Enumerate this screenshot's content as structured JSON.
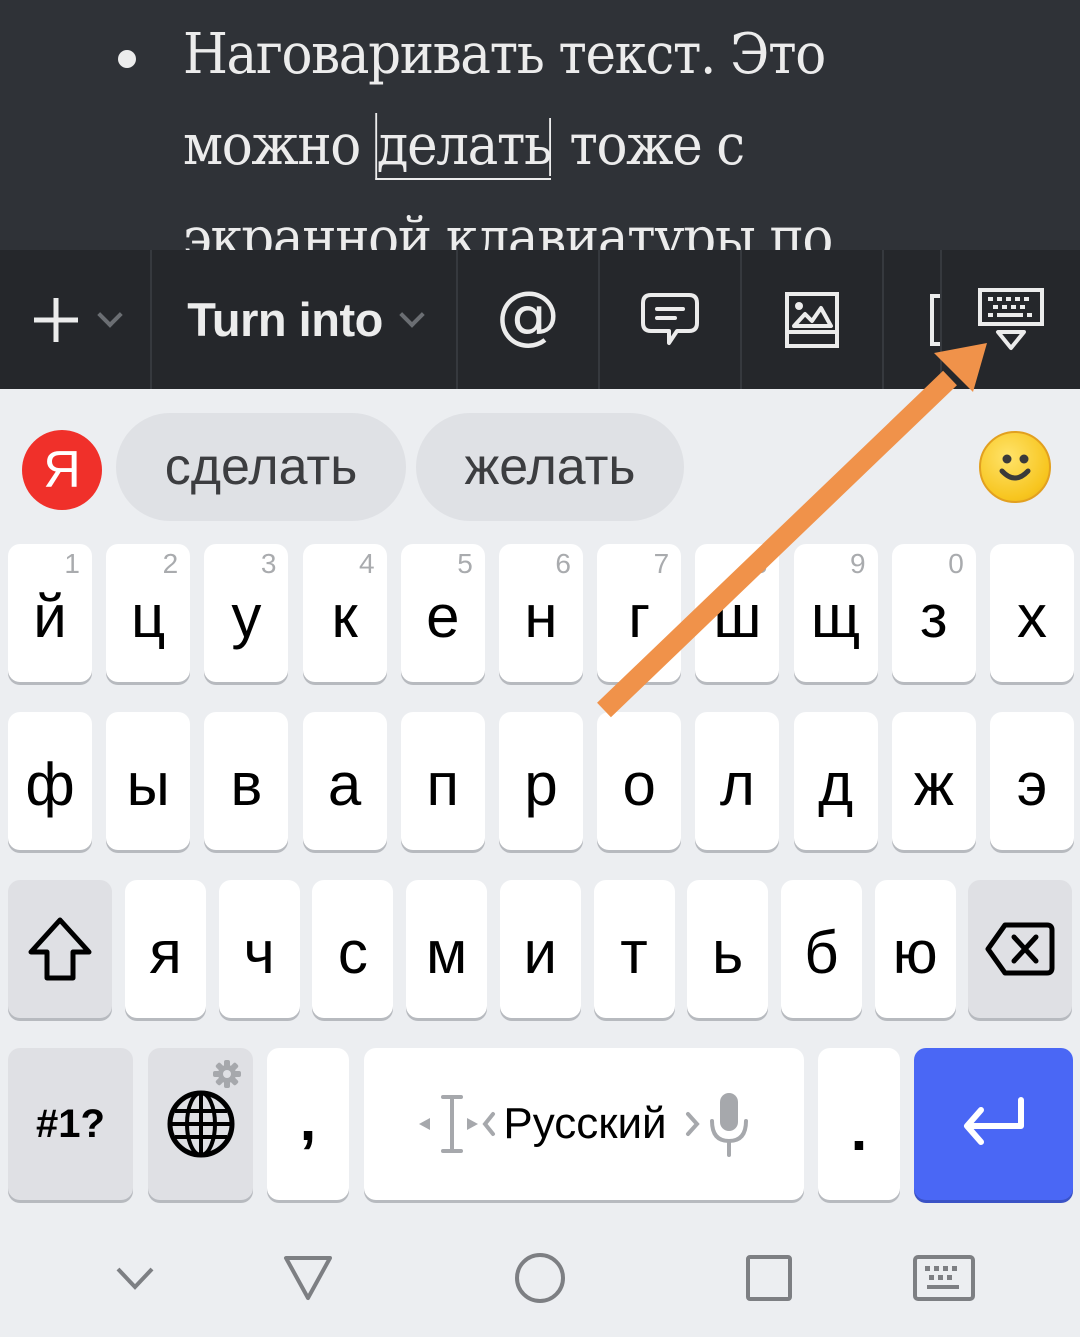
{
  "document": {
    "bullet_lines": [
      "Наговаривать текст. Это",
      "можно",
      "делать",
      "тоже с",
      "экранной клавиатуры по"
    ],
    "selected_word": "делать"
  },
  "toolbar": {
    "add_icon": "plus-icon",
    "turn_into_label": "Turn into",
    "mention_label": "@",
    "items": [
      "add",
      "turn-into",
      "mention",
      "comment",
      "image",
      "bracket",
      "hide-keyboard"
    ]
  },
  "suggestions": {
    "brand_letter": "Я",
    "words": [
      "сделать",
      "желать"
    ],
    "emoji_icon": "smiley-icon"
  },
  "keyboard": {
    "layout": "Русский",
    "row1": [
      {
        "ch": "й",
        "hint": "1"
      },
      {
        "ch": "ц",
        "hint": "2"
      },
      {
        "ch": "у",
        "hint": "3"
      },
      {
        "ch": "к",
        "hint": "4"
      },
      {
        "ch": "е",
        "hint": "5"
      },
      {
        "ch": "н",
        "hint": "6"
      },
      {
        "ch": "г",
        "hint": "7"
      },
      {
        "ch": "ш",
        "hint": "8"
      },
      {
        "ch": "щ",
        "hint": "9"
      },
      {
        "ch": "з",
        "hint": "0"
      },
      {
        "ch": "х",
        "hint": ""
      }
    ],
    "row2": [
      "ф",
      "ы",
      "в",
      "а",
      "п",
      "р",
      "о",
      "л",
      "д",
      "ж",
      "э"
    ],
    "row3": [
      "я",
      "ч",
      "с",
      "м",
      "и",
      "т",
      "ь",
      "б",
      "ю"
    ],
    "symbols_label": "#1?",
    "comma": ",",
    "period": ".",
    "enter_color": "#4a67f5"
  },
  "annotation": {
    "color": "#f0924a",
    "points_to": "hide-keyboard-button"
  },
  "navbar": [
    "hide-keyboard-chevron",
    "back",
    "home",
    "recents",
    "keyboard-switch"
  ]
}
